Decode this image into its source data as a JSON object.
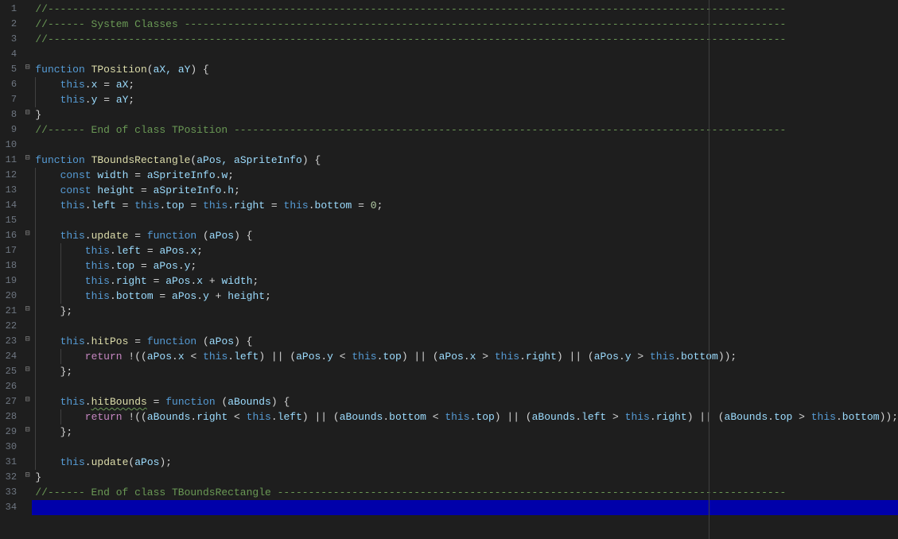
{
  "lineCount": 34,
  "foldMarkers": {
    "5": "⊟",
    "8": "⊟",
    "11": "⊟",
    "16": "⊟",
    "21": "⊟",
    "23": "⊟",
    "25": "⊟",
    "27": "⊟",
    "29": "⊟",
    "32": "⊟"
  },
  "colors": {
    "background": "#1e1e1e",
    "currentLine": "#0000aa",
    "comment": "#6a9955",
    "keyword": "#569cd6",
    "function": "#dcdcaa",
    "variable": "#9cdcfe",
    "number": "#b5cea8",
    "return": "#c586c0",
    "default": "#d4d4d4"
  },
  "rulerColumn": 120,
  "currentLine": 34,
  "code": {
    "l1": {
      "t": "comment",
      "text": "//-----------------------------------------------------------------------------------------------------------------------"
    },
    "l2": {
      "t": "comment",
      "text": "//------ System Classes -------------------------------------------------------------------------------------------------"
    },
    "l3": {
      "t": "comment",
      "text": "//-----------------------------------------------------------------------------------------------------------------------"
    },
    "l4": {
      "t": "blank"
    },
    "l5": {
      "t": "func",
      "kw": "function",
      "name": "TPosition",
      "params": "aX, aY",
      "tail": " {"
    },
    "l6": {
      "t": "stmt",
      "indent": 1,
      "parts": [
        [
          "this",
          "this"
        ],
        [
          ".",
          "p"
        ],
        [
          "x",
          "prop"
        ],
        [
          " = ",
          "p"
        ],
        [
          "aX",
          "prop"
        ],
        [
          ";",
          "p"
        ]
      ]
    },
    "l7": {
      "t": "stmt",
      "indent": 1,
      "parts": [
        [
          "this",
          "this"
        ],
        [
          ".",
          "p"
        ],
        [
          "y",
          "prop"
        ],
        [
          " = ",
          "p"
        ],
        [
          "aY",
          "prop"
        ],
        [
          ";",
          "p"
        ]
      ]
    },
    "l8": {
      "t": "close",
      "text": "}"
    },
    "l9": {
      "t": "comment",
      "text": "//------ End of class TPosition -----------------------------------------------------------------------------------------"
    },
    "l10": {
      "t": "blank"
    },
    "l11": {
      "t": "func",
      "kw": "function",
      "name": "TBoundsRectangle",
      "params": "aPos, aSpriteInfo",
      "tail": " {"
    },
    "l12": {
      "t": "stmt",
      "indent": 1,
      "parts": [
        [
          "const",
          "kw"
        ],
        [
          " ",
          "p"
        ],
        [
          "width",
          "prop"
        ],
        [
          " = ",
          "p"
        ],
        [
          "aSpriteInfo",
          "prop"
        ],
        [
          ".",
          "p"
        ],
        [
          "w",
          "prop"
        ],
        [
          ";",
          "p"
        ]
      ]
    },
    "l13": {
      "t": "stmt",
      "indent": 1,
      "parts": [
        [
          "const",
          "kw"
        ],
        [
          " ",
          "p"
        ],
        [
          "height",
          "prop"
        ],
        [
          " = ",
          "p"
        ],
        [
          "aSpriteInfo",
          "prop"
        ],
        [
          ".",
          "p"
        ],
        [
          "h",
          "prop"
        ],
        [
          ";",
          "p"
        ]
      ]
    },
    "l14": {
      "t": "stmt",
      "indent": 1,
      "parts": [
        [
          "this",
          "this"
        ],
        [
          ".",
          "p"
        ],
        [
          "left",
          "prop"
        ],
        [
          " = ",
          "p"
        ],
        [
          "this",
          "this"
        ],
        [
          ".",
          "p"
        ],
        [
          "top",
          "prop"
        ],
        [
          " = ",
          "p"
        ],
        [
          "this",
          "this"
        ],
        [
          ".",
          "p"
        ],
        [
          "right",
          "prop"
        ],
        [
          " = ",
          "p"
        ],
        [
          "this",
          "this"
        ],
        [
          ".",
          "p"
        ],
        [
          "bottom",
          "prop"
        ],
        [
          " = ",
          "p"
        ],
        [
          "0",
          "num"
        ],
        [
          ";",
          "p"
        ]
      ]
    },
    "l15": {
      "t": "blank-indent",
      "indent": 1
    },
    "l16": {
      "t": "stmt",
      "indent": 1,
      "parts": [
        [
          "this",
          "this"
        ],
        [
          ".",
          "p"
        ],
        [
          "update",
          "fname"
        ],
        [
          " = ",
          "p"
        ],
        [
          "function",
          "kw"
        ],
        [
          " (",
          "p"
        ],
        [
          "aPos",
          "prop"
        ],
        [
          ") {",
          "p"
        ]
      ]
    },
    "l17": {
      "t": "stmt",
      "indent": 2,
      "parts": [
        [
          "this",
          "this"
        ],
        [
          ".",
          "p"
        ],
        [
          "left",
          "prop"
        ],
        [
          " = ",
          "p"
        ],
        [
          "aPos",
          "prop"
        ],
        [
          ".",
          "p"
        ],
        [
          "x",
          "prop"
        ],
        [
          ";",
          "p"
        ]
      ]
    },
    "l18": {
      "t": "stmt",
      "indent": 2,
      "parts": [
        [
          "this",
          "this"
        ],
        [
          ".",
          "p"
        ],
        [
          "top",
          "prop"
        ],
        [
          " = ",
          "p"
        ],
        [
          "aPos",
          "prop"
        ],
        [
          ".",
          "p"
        ],
        [
          "y",
          "prop"
        ],
        [
          ";",
          "p"
        ]
      ]
    },
    "l19": {
      "t": "stmt",
      "indent": 2,
      "parts": [
        [
          "this",
          "this"
        ],
        [
          ".",
          "p"
        ],
        [
          "right",
          "prop"
        ],
        [
          " = ",
          "p"
        ],
        [
          "aPos",
          "prop"
        ],
        [
          ".",
          "p"
        ],
        [
          "x",
          "prop"
        ],
        [
          " + ",
          "p"
        ],
        [
          "width",
          "prop"
        ],
        [
          ";",
          "p"
        ]
      ]
    },
    "l20": {
      "t": "stmt",
      "indent": 2,
      "parts": [
        [
          "this",
          "this"
        ],
        [
          ".",
          "p"
        ],
        [
          "bottom",
          "prop"
        ],
        [
          " = ",
          "p"
        ],
        [
          "aPos",
          "prop"
        ],
        [
          ".",
          "p"
        ],
        [
          "y",
          "prop"
        ],
        [
          " + ",
          "p"
        ],
        [
          "height",
          "prop"
        ],
        [
          ";",
          "p"
        ]
      ]
    },
    "l21": {
      "t": "stmt",
      "indent": 1,
      "parts": [
        [
          "};",
          "p"
        ]
      ]
    },
    "l22": {
      "t": "blank-indent",
      "indent": 1
    },
    "l23": {
      "t": "stmt",
      "indent": 1,
      "parts": [
        [
          "this",
          "this"
        ],
        [
          ".",
          "p"
        ],
        [
          "hitPos",
          "fname"
        ],
        [
          " = ",
          "p"
        ],
        [
          "function",
          "kw"
        ],
        [
          " (",
          "p"
        ],
        [
          "aPos",
          "prop"
        ],
        [
          ") {",
          "p"
        ]
      ]
    },
    "l24": {
      "t": "stmt",
      "indent": 2,
      "parts": [
        [
          "return",
          "ret"
        ],
        [
          " !((",
          "p"
        ],
        [
          "aPos",
          "prop"
        ],
        [
          ".",
          "p"
        ],
        [
          "x",
          "prop"
        ],
        [
          " < ",
          "p"
        ],
        [
          "this",
          "this"
        ],
        [
          ".",
          "p"
        ],
        [
          "left",
          "prop"
        ],
        [
          ") || (",
          "p"
        ],
        [
          "aPos",
          "prop"
        ],
        [
          ".",
          "p"
        ],
        [
          "y",
          "prop"
        ],
        [
          " < ",
          "p"
        ],
        [
          "this",
          "this"
        ],
        [
          ".",
          "p"
        ],
        [
          "top",
          "prop"
        ],
        [
          ") || (",
          "p"
        ],
        [
          "aPos",
          "prop"
        ],
        [
          ".",
          "p"
        ],
        [
          "x",
          "prop"
        ],
        [
          " > ",
          "p"
        ],
        [
          "this",
          "this"
        ],
        [
          ".",
          "p"
        ],
        [
          "right",
          "prop"
        ],
        [
          ") || (",
          "p"
        ],
        [
          "aPos",
          "prop"
        ],
        [
          ".",
          "p"
        ],
        [
          "y",
          "prop"
        ],
        [
          " > ",
          "p"
        ],
        [
          "this",
          "this"
        ],
        [
          ".",
          "p"
        ],
        [
          "bottom",
          "prop"
        ],
        [
          "));",
          "p"
        ]
      ]
    },
    "l25": {
      "t": "stmt",
      "indent": 1,
      "parts": [
        [
          "};",
          "p"
        ]
      ]
    },
    "l26": {
      "t": "blank-indent",
      "indent": 1
    },
    "l27": {
      "t": "stmt",
      "indent": 1,
      "parts": [
        [
          "this",
          "this"
        ],
        [
          ".",
          "p"
        ],
        [
          "hitBounds",
          "fname-u"
        ],
        [
          " = ",
          "p"
        ],
        [
          "function",
          "kw"
        ],
        [
          " (",
          "p"
        ],
        [
          "aBounds",
          "prop"
        ],
        [
          ") {",
          "p"
        ]
      ]
    },
    "l28": {
      "t": "stmt",
      "indent": 2,
      "parts": [
        [
          "return",
          "ret"
        ],
        [
          " !((",
          "p"
        ],
        [
          "aBounds",
          "prop"
        ],
        [
          ".",
          "p"
        ],
        [
          "right",
          "prop"
        ],
        [
          " < ",
          "p"
        ],
        [
          "this",
          "this"
        ],
        [
          ".",
          "p"
        ],
        [
          "left",
          "prop"
        ],
        [
          ") || (",
          "p"
        ],
        [
          "aBounds",
          "prop"
        ],
        [
          ".",
          "p"
        ],
        [
          "bottom",
          "prop"
        ],
        [
          " < ",
          "p"
        ],
        [
          "this",
          "this"
        ],
        [
          ".",
          "p"
        ],
        [
          "top",
          "prop"
        ],
        [
          ") || (",
          "p"
        ],
        [
          "aBounds",
          "prop"
        ],
        [
          ".",
          "p"
        ],
        [
          "left",
          "prop"
        ],
        [
          " > ",
          "p"
        ],
        [
          "this",
          "this"
        ],
        [
          ".",
          "p"
        ],
        [
          "right",
          "prop"
        ],
        [
          ") || (",
          "p"
        ],
        [
          "aBounds",
          "prop"
        ],
        [
          ".",
          "p"
        ],
        [
          "top",
          "prop"
        ],
        [
          " > ",
          "p"
        ],
        [
          "this",
          "this"
        ],
        [
          ".",
          "p"
        ],
        [
          "bottom",
          "prop"
        ],
        [
          "));",
          "p"
        ]
      ]
    },
    "l29": {
      "t": "stmt",
      "indent": 1,
      "parts": [
        [
          "};",
          "p"
        ]
      ]
    },
    "l30": {
      "t": "blank-indent",
      "indent": 1
    },
    "l31": {
      "t": "stmt",
      "indent": 1,
      "parts": [
        [
          "this",
          "this"
        ],
        [
          ".",
          "p"
        ],
        [
          "update",
          "fname"
        ],
        [
          "(",
          "p"
        ],
        [
          "aPos",
          "prop"
        ],
        [
          ");",
          "p"
        ]
      ]
    },
    "l32": {
      "t": "close",
      "text": "}"
    },
    "l33": {
      "t": "comment",
      "text": "//------ End of class TBoundsRectangle ----------------------------------------------------------------------------------"
    },
    "l34": {
      "t": "blank"
    }
  }
}
